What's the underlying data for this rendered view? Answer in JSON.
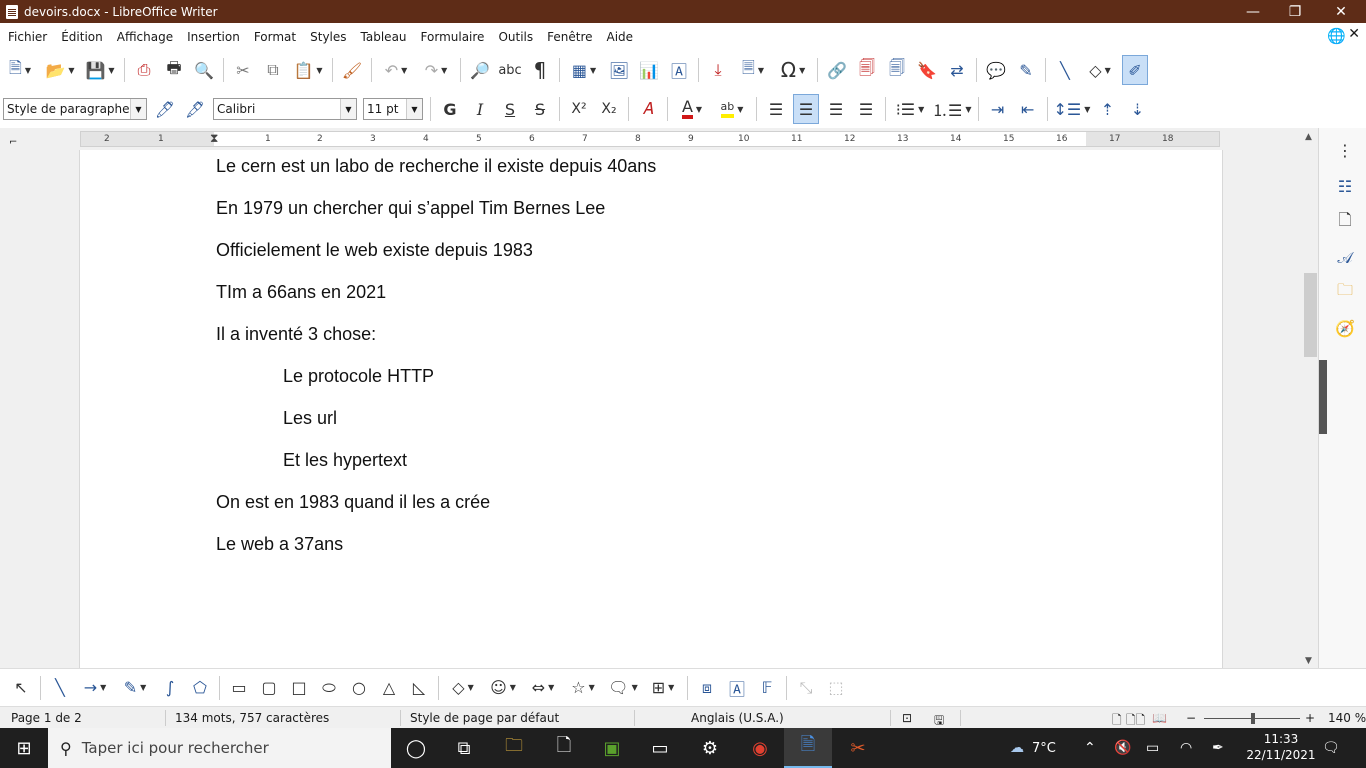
{
  "window": {
    "title": "devoirs.docx - LibreOffice Writer",
    "controls": [
      "minimize-icon",
      "maximize-icon",
      "close-icon"
    ]
  },
  "menubar": {
    "items": [
      "Fichier",
      "Édition",
      "Affichage",
      "Insertion",
      "Format",
      "Styles",
      "Tableau",
      "Formulaire",
      "Outils",
      "Fenêtre",
      "Aide"
    ]
  },
  "format_bar": {
    "paragraph_style": "Style de paragraphe par",
    "font_name": "Calibri",
    "font_size": "11 pt",
    "bold": "G",
    "italic": "I",
    "underline": "S",
    "strike": "S",
    "superscript": "X²",
    "subscript": "X₂",
    "font_color": "A",
    "highlight": "ab",
    "colors": {
      "font_color": "#d01818",
      "highlight": "#ffee00",
      "active": "#c9dff7"
    }
  },
  "ruler": {
    "ticks": [
      "2",
      "1",
      "1",
      "2",
      "3",
      "4",
      "5",
      "6",
      "7",
      "8",
      "9",
      "10",
      "11",
      "12",
      "13",
      "14",
      "15",
      "16",
      "17",
      "18"
    ]
  },
  "document": {
    "paragraphs": [
      "Le cern est un labo de recherche il existe depuis 40ans",
      "En 1979 un chercher qui s’appel Tim Bernes Lee",
      "Officielement le web existe depuis 1983",
      "TIm a 66ans en 2021",
      "Il a inventé 3 chose:",
      "Le protocole HTTP",
      "Les url",
      "Et les hypertext",
      "On est en 1983 quand il les a crée",
      "Le web a 37ans"
    ]
  },
  "statusbar": {
    "page": "Page 1 de 2",
    "words": "134 mots, 757 caractères",
    "page_style": "Style de page par défaut",
    "language": "Anglais (U.S.A.)",
    "zoom": "140 %",
    "zoom_minus": "−",
    "zoom_plus": "+"
  },
  "taskbar": {
    "search_placeholder": "Taper ici pour rechercher",
    "weather": "7°C",
    "time": "11:33",
    "date": "22/11/2021"
  }
}
